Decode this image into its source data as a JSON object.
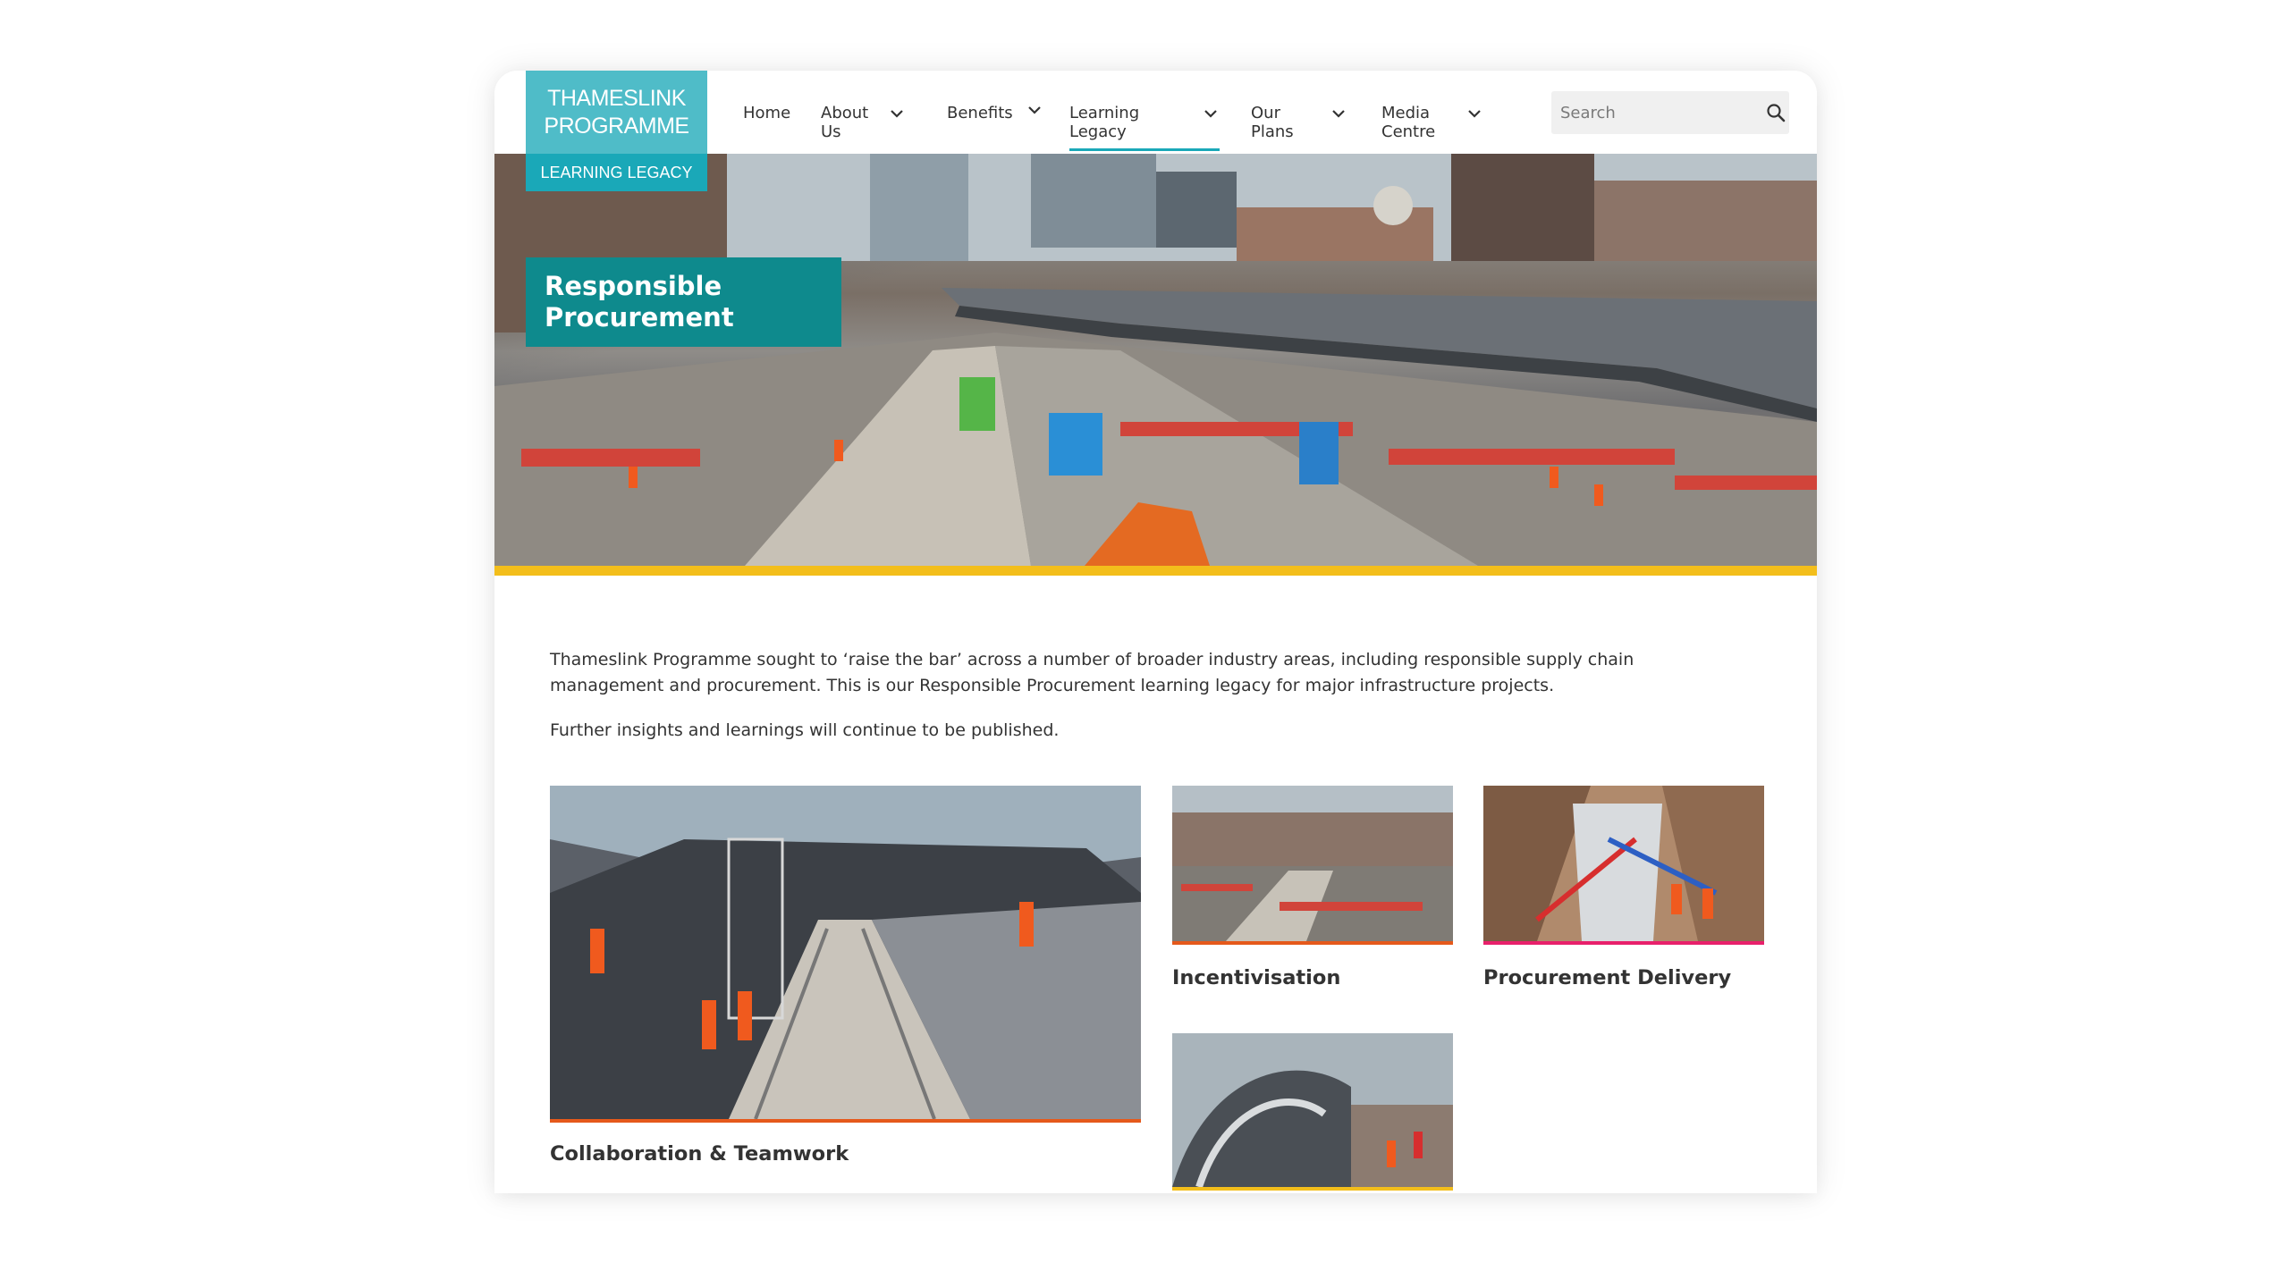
{
  "logo": {
    "line1": "THAMESLINK",
    "line2": "PROGRAMME",
    "subtitle": "LEARNING LEGACY",
    "colors": {
      "main": "#4fbcc8",
      "sub": "#1aa8b8"
    }
  },
  "nav": {
    "items": [
      {
        "label": "Home",
        "dropdown": false,
        "active": false
      },
      {
        "label": "About\nUs",
        "dropdown": true,
        "active": false
      },
      {
        "label": "Benefits",
        "dropdown": true,
        "active": false
      },
      {
        "label": "Learning\nLegacy",
        "dropdown": true,
        "active": true
      },
      {
        "label": "Our\nPlans",
        "dropdown": true,
        "active": false
      },
      {
        "label": "Media\nCentre",
        "dropdown": true,
        "active": false
      }
    ],
    "chevron_icon": "chevron-down-icon"
  },
  "search": {
    "placeholder": "Search",
    "icon": "search-icon"
  },
  "hero": {
    "title_line1": "Responsible",
    "title_line2": "Procurement",
    "title_bg": "#0e8a8d",
    "accent": "#f3be1b"
  },
  "intro": {
    "paragraph1": "Thameslink Programme sought to ‘raise the bar’ across a number of broader industry areas, including responsible supply chain management and procurement. This is our Responsible Procurement learning legacy for major infrastructure projects.",
    "paragraph2": "Further insights and learnings will continue to be published."
  },
  "cards": [
    {
      "title": "Collaboration & Teamwork",
      "accent": "#e5591b"
    },
    {
      "title": "Incentivisation",
      "accent": "#e5591b"
    },
    {
      "title": "Procurement Delivery",
      "accent": "#e8206b"
    },
    {
      "title": "",
      "accent": "#f3be1b"
    }
  ]
}
